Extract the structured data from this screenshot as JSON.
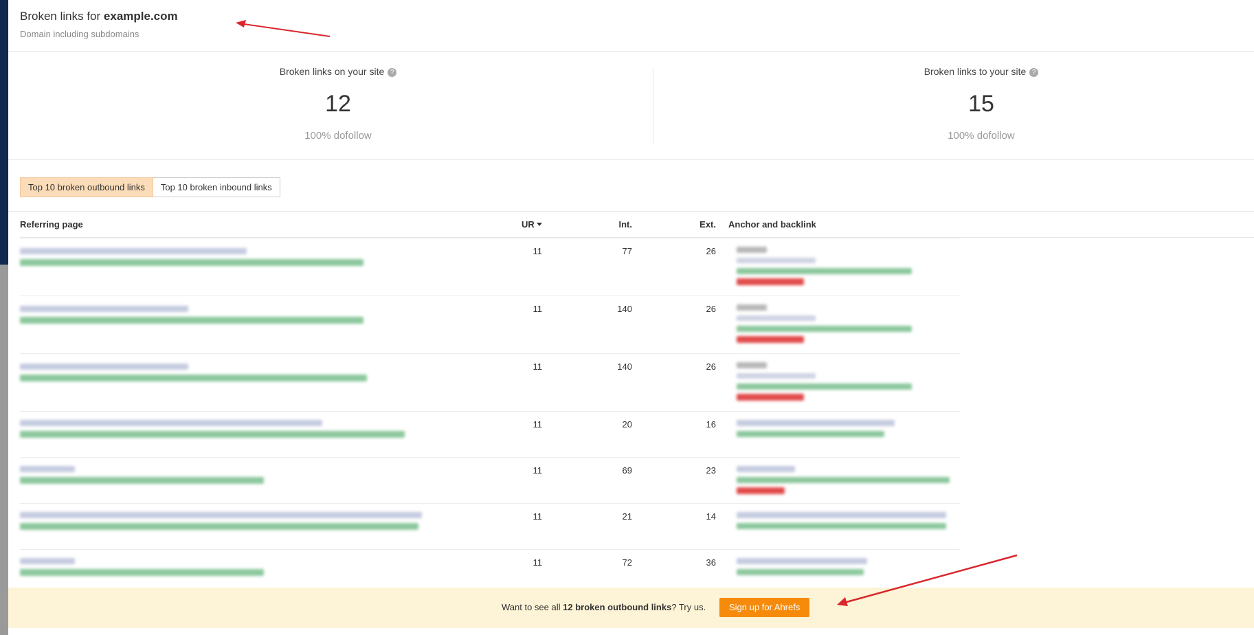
{
  "header": {
    "title_prefix": "Broken links for",
    "domain": "example.com",
    "subtitle": "Domain including subdomains"
  },
  "stats": [
    {
      "label": "Broken links on your site",
      "value": "12",
      "sub": "100% dofollow"
    },
    {
      "label": "Broken links to your site",
      "value": "15",
      "sub": "100% dofollow"
    }
  ],
  "tabs": [
    {
      "label": "Top 10 broken outbound links",
      "active": true
    },
    {
      "label": "Top 10 broken inbound links",
      "active": false
    }
  ],
  "table": {
    "columns": [
      "Referring page",
      "UR",
      "Int.",
      "Ext.",
      "Anchor and backlink"
    ],
    "rows": [
      {
        "ur": "11",
        "int": "77",
        "ext": "26"
      },
      {
        "ur": "11",
        "int": "140",
        "ext": "26"
      },
      {
        "ur": "11",
        "int": "140",
        "ext": "26"
      },
      {
        "ur": "11",
        "int": "20",
        "ext": "16"
      },
      {
        "ur": "11",
        "int": "69",
        "ext": "23"
      },
      {
        "ur": "11",
        "int": "21",
        "ext": "14"
      },
      {
        "ur": "11",
        "int": "72",
        "ext": "36"
      }
    ]
  },
  "promo": {
    "prefix": "Want to see all",
    "bold": "12 broken outbound links",
    "suffix": "? Try us.",
    "button": "Sign up for Ahrefs"
  },
  "colors": {
    "accent": "#f58a0b",
    "active_tab": "#fbdcb8",
    "promo_bg": "#fdf3d6",
    "sidebar": "#0f2a4e",
    "arrow": "#d9262b"
  }
}
